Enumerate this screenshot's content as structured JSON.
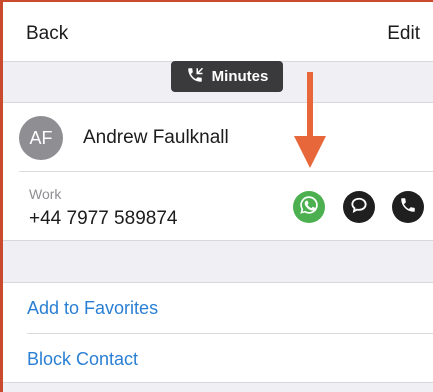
{
  "nav": {
    "back_label": "Back",
    "edit_label": "Edit"
  },
  "banner": {
    "label": "Minutes",
    "icon": "phone-incoming-icon"
  },
  "contact": {
    "initials": "AF",
    "name": "Andrew Faulknall",
    "phone_label": "Work",
    "phone_number": "+44 7977 589874"
  },
  "actions": [
    {
      "name": "whatsapp",
      "icon": "whatsapp-icon",
      "color": "#4caf50"
    },
    {
      "name": "message",
      "icon": "speech-bubble-icon",
      "color": "#1f1f1f"
    },
    {
      "name": "call",
      "icon": "phone-icon",
      "color": "#1f1f1f"
    }
  ],
  "annotation": {
    "icon": "arrow-down-icon",
    "color": "#e8673a"
  },
  "list": {
    "favorites_label": "Add to Favorites",
    "block_label": "Block Contact"
  },
  "colors": {
    "link": "#2a7fd4",
    "frame": "#c94a2c",
    "background": "#efeff4"
  }
}
